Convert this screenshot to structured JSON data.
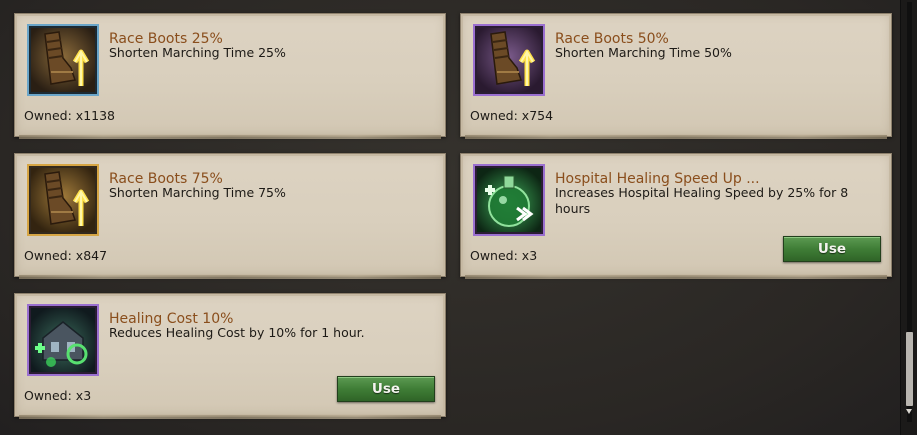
{
  "items": [
    {
      "title": "Race Boots 25%",
      "description": "Shorten Marching Time 25%",
      "owned": "Owned: x1138",
      "icon": "race-boots-icon",
      "frame_color": "#6aa5c9"
    },
    {
      "title": "Race Boots 50%",
      "description": "Shorten Marching Time 50%",
      "owned": "Owned: x754",
      "icon": "race-boots-icon",
      "frame_color": "#9a6fd0"
    },
    {
      "title": "Race Boots 75%",
      "description": "Shorten Marching Time 75%",
      "owned": "Owned: x847",
      "icon": "race-boots-icon",
      "frame_color": "#d6a544"
    },
    {
      "title": "Hospital Healing Speed Up ...",
      "description": "Increases Hospital Healing Speed by 25% for 8 hours",
      "owned": "Owned: x3",
      "icon": "healing-speed-potion-icon",
      "frame_color": "#9a6fd0",
      "action_label": "Use"
    },
    {
      "title": "Healing Cost 10%",
      "description": "Reduces Healing Cost by 10% for 1 hour.",
      "owned": "Owned: x3",
      "icon": "healing-cost-hospital-icon",
      "frame_color": "#9a6fd0",
      "action_label": "Use"
    }
  ],
  "colors": {
    "title": "#8a4e1c",
    "button": "#3f7d36",
    "card": "#d9cfbd"
  }
}
